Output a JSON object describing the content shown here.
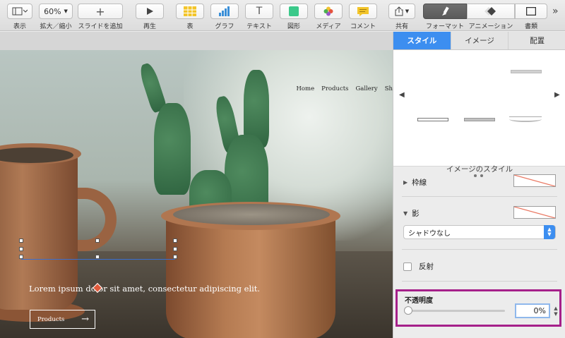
{
  "toolbar": {
    "view": {
      "label": "表示"
    },
    "zoom": {
      "value": "60%",
      "label": "拡大／縮小"
    },
    "add_slide": {
      "label": "スライドを追加"
    },
    "play": {
      "label": "再生"
    },
    "table": {
      "label": "表"
    },
    "chart": {
      "label": "グラフ"
    },
    "text": {
      "label": "テキスト",
      "glyph": "T"
    },
    "shape": {
      "label": "図形"
    },
    "media": {
      "label": "メディア"
    },
    "comment": {
      "label": "コメント"
    },
    "share": {
      "label": "共有"
    },
    "format": {
      "label": "フォーマット"
    },
    "animate": {
      "label": "アニメーション"
    },
    "document": {
      "label": "書類"
    },
    "more": {
      "glyph": "»"
    }
  },
  "slide": {
    "nav": [
      "Home",
      "Products",
      "Gallery",
      "Sh"
    ],
    "body_text": "Lorem ipsum dolor sit amet, consectetur adipiscing elit.",
    "button_label": "Products",
    "button_arrow": "→"
  },
  "inspector": {
    "tabs": [
      "スタイル",
      "イメージ",
      "配置"
    ],
    "active_tab": "スタイル",
    "styles_label": "イメージのスタイル",
    "border_label": "枠線",
    "shadow_label": "影",
    "shadow_value": "シャドウなし",
    "reflection_label": "反射",
    "opacity_label": "不透明度",
    "opacity_value": "0%",
    "opacity_fraction": 0
  },
  "colors": {
    "accent": "#3c8ef0",
    "highlight": "#a5208a"
  }
}
